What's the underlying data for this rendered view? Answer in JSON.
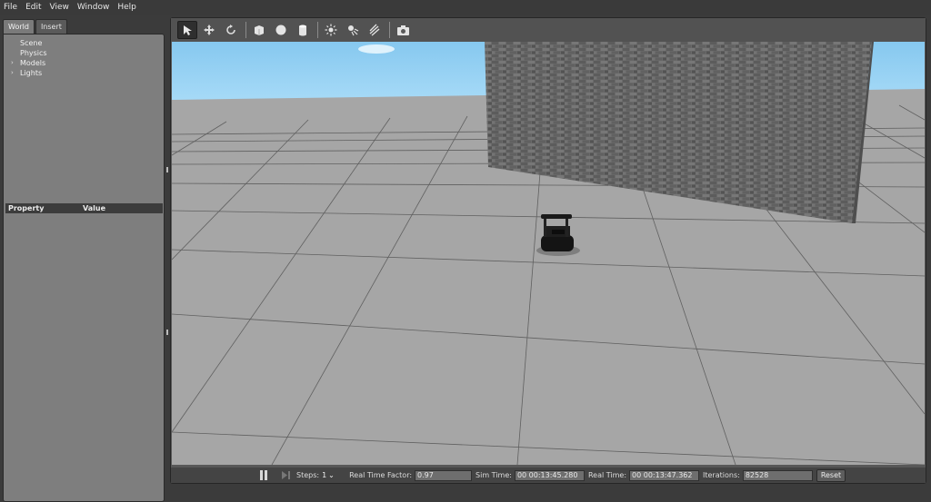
{
  "menu": [
    "File",
    "Edit",
    "View",
    "Window",
    "Help"
  ],
  "tabs": {
    "world": "World",
    "insert": "Insert"
  },
  "tree": {
    "scene": "Scene",
    "physics": "Physics",
    "models": "Models",
    "lights": "Lights"
  },
  "properties": {
    "col_property": "Property",
    "col_value": "Value"
  },
  "toolbar": {
    "icons": [
      "select-arrow-icon",
      "translate-icon",
      "rotate-icon",
      "box-icon",
      "sphere-icon",
      "cylinder-icon",
      "point-light-icon",
      "spot-light-icon",
      "directional-light-icon",
      "screenshot-camera-icon"
    ]
  },
  "status": {
    "steps_label": "Steps:",
    "steps_value": "1",
    "rtf_label": "Real Time Factor:",
    "rtf_value": "0.97",
    "simtime_label": "Sim Time:",
    "simtime_value": "00 00:13:45.280",
    "realtime_label": "Real Time:",
    "realtime_value": "00 00:13:47.362",
    "iterations_label": "Iterations:",
    "iterations_value": "82528",
    "reset_label": "Reset"
  },
  "colors": {
    "sky": "#8ed0f5",
    "ground": "#a5a5a5",
    "wall": "#6c6c6c",
    "grid_line": "#5c5c5c",
    "robot": "#1a1a1a"
  }
}
